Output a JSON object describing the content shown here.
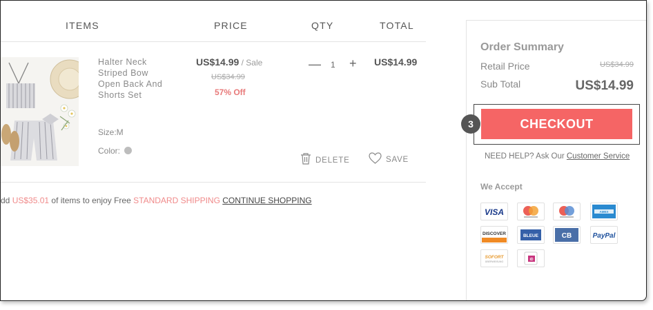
{
  "columns": {
    "items": "ITEMS",
    "price": "PRICE",
    "qty": "QTY",
    "total": "TOTAL"
  },
  "product": {
    "name": "Halter Neck Striped Bow Open Back And Shorts Set",
    "price": "US$14.99",
    "price_tag": " / Sale",
    "original_price": "US$34.99",
    "discount": "57% Off",
    "size": "Size:M",
    "color_label": "Color:",
    "color_swatch": "#bdbdbd",
    "quantity": "1",
    "total": "US$14.99",
    "delete_label": "DELETE",
    "save_label": "SAVE"
  },
  "shipping_notice": {
    "prefix": "dd ",
    "amount": "US$35.01",
    "middle": " of items to enjoy Free ",
    "shipping_type": "STANDARD SHIPPING",
    "link": "CONTINUE SHOPPING"
  },
  "summary": {
    "title": "Order Summary",
    "retail_label": "Retail Price",
    "retail_value": "US$34.99",
    "subtotal_label": "Sub Total",
    "subtotal_value": "US$14.99",
    "checkout_label": "CHECKOUT",
    "step_number": "3",
    "help_text": "NEED HELP? Ask Our ",
    "help_link": "Customer Service",
    "accept_title": "We Accept"
  },
  "payment_methods": [
    {
      "name": "VISA",
      "icon": "visa-icon"
    },
    {
      "name": "Maestro",
      "icon": "maestro-icon"
    },
    {
      "name": "MasterCard",
      "icon": "mastercard-icon"
    },
    {
      "name": "AMERICAN EXPRESS",
      "icon": "amex-icon"
    },
    {
      "name": "DISCOVER",
      "icon": "discover-icon"
    },
    {
      "name": "E-BLEUE",
      "icon": "ebleue-icon"
    },
    {
      "name": "CB",
      "icon": "cb-icon"
    },
    {
      "name": "PayPal",
      "icon": "paypal-icon"
    },
    {
      "name": "SOFORT ÜBERWEISUNG",
      "icon": "sofort-icon"
    },
    {
      "name": "iDEAL",
      "icon": "ideal-icon"
    }
  ],
  "colors": {
    "accent": "#f56565",
    "discount": "#e87a7a",
    "shipping_highlight": "#f08a8a"
  }
}
